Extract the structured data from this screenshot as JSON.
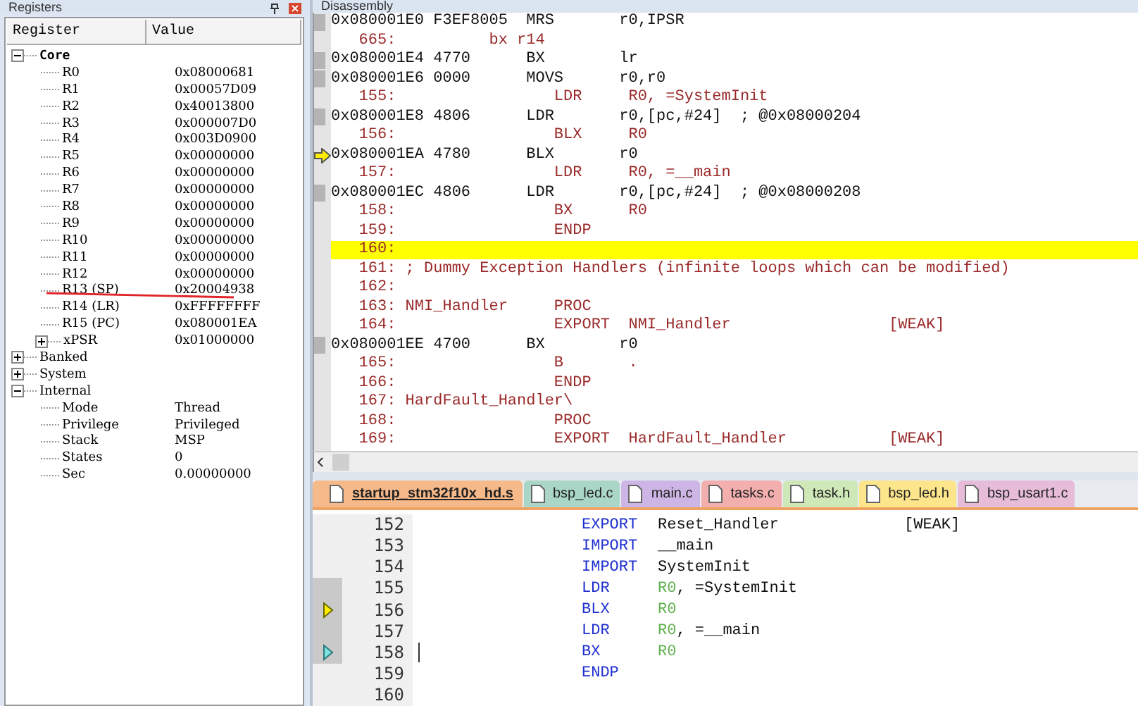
{
  "registers": {
    "title": "Registers",
    "columns": [
      "Register",
      "Value"
    ],
    "tree": [
      {
        "name": "Core",
        "bold": true,
        "expanded": true,
        "children": [
          {
            "name": "R0",
            "value": "0x08000681"
          },
          {
            "name": "R1",
            "value": "0x00057D09"
          },
          {
            "name": "R2",
            "value": "0x40013800"
          },
          {
            "name": "R3",
            "value": "0x000007D0"
          },
          {
            "name": "R4",
            "value": "0x003D0900"
          },
          {
            "name": "R5",
            "value": "0x00000000"
          },
          {
            "name": "R6",
            "value": "0x00000000"
          },
          {
            "name": "R7",
            "value": "0x00000000"
          },
          {
            "name": "R8",
            "value": "0x00000000"
          },
          {
            "name": "R9",
            "value": "0x00000000"
          },
          {
            "name": "R10",
            "value": "0x00000000"
          },
          {
            "name": "R11",
            "value": "0x00000000"
          },
          {
            "name": "R12",
            "value": "0x00000000"
          },
          {
            "name": "R13 (SP)",
            "value": "0x20004938"
          },
          {
            "name": "R14 (LR)",
            "value": "0xFFFFFFFF"
          },
          {
            "name": "R15 (PC)",
            "value": "0x080001EA"
          },
          {
            "name": "xPSR",
            "value": "0x01000000",
            "expanded": false
          }
        ]
      },
      {
        "name": "Banked",
        "bold": false,
        "expanded": false
      },
      {
        "name": "System",
        "bold": false,
        "expanded": false
      },
      {
        "name": "Internal",
        "bold": false,
        "expanded": true,
        "children": [
          {
            "name": "Mode",
            "value": "Thread"
          },
          {
            "name": "Privilege",
            "value": "Privileged"
          },
          {
            "name": "Stack",
            "value": "MSP"
          },
          {
            "name": "States",
            "value": "0"
          },
          {
            "name": "Sec",
            "value": "0.00000000"
          }
        ]
      }
    ]
  },
  "disassembly": {
    "title": "Disassembly",
    "lines": [
      {
        "kind": "asm",
        "text": "0x080001E0 F3EF8005  MRS       r0,IPSR",
        "current": false,
        "highlighted": false
      },
      {
        "kind": "src",
        "text": "   665:          bx r14",
        "current": false,
        "highlighted": false
      },
      {
        "kind": "asm",
        "text": "0x080001E4 4770      BX        lr",
        "current": false,
        "highlighted": false
      },
      {
        "kind": "asm",
        "text": "0x080001E6 0000      MOVS      r0,r0",
        "current": false,
        "highlighted": false
      },
      {
        "kind": "src",
        "text": "   155:                 LDR     R0, =SystemInit",
        "current": false,
        "highlighted": false
      },
      {
        "kind": "asm",
        "text": "0x080001E8 4806      LDR       r0,[pc,#24]  ; @0x08000204",
        "current": false,
        "highlighted": false
      },
      {
        "kind": "src",
        "text": "   156:                 BLX     R0",
        "current": false,
        "highlighted": false
      },
      {
        "kind": "asm",
        "text": "0x080001EA 4780      BLX       r0",
        "current": true,
        "highlighted": false
      },
      {
        "kind": "src",
        "text": "   157:                 LDR     R0, =__main",
        "current": false,
        "highlighted": false
      },
      {
        "kind": "asm",
        "text": "0x080001EC 4806      LDR       r0,[pc,#24]  ; @0x08000208",
        "current": false,
        "highlighted": false
      },
      {
        "kind": "src",
        "text": "   158:                 BX      R0",
        "current": false,
        "highlighted": false
      },
      {
        "kind": "src",
        "text": "   159:                 ENDP",
        "current": false,
        "highlighted": false
      },
      {
        "kind": "src",
        "text": "   160:",
        "current": false,
        "highlighted": true
      },
      {
        "kind": "src",
        "text": "   161: ; Dummy Exception Handlers (infinite loops which can be modified)",
        "current": false,
        "highlighted": false
      },
      {
        "kind": "src",
        "text": "   162:",
        "current": false,
        "highlighted": false
      },
      {
        "kind": "src",
        "text": "   163: NMI_Handler     PROC",
        "current": false,
        "highlighted": false
      },
      {
        "kind": "src",
        "text": "   164:                 EXPORT  NMI_Handler                 [WEAK]",
        "current": false,
        "highlighted": false
      },
      {
        "kind": "asm",
        "text": "0x080001EE 4700      BX        r0",
        "current": false,
        "highlighted": false
      },
      {
        "kind": "src",
        "text": "   165:                 B       .",
        "current": false,
        "highlighted": false
      },
      {
        "kind": "src",
        "text": "   166:                 ENDP",
        "current": false,
        "highlighted": false
      },
      {
        "kind": "src",
        "text": "   167: HardFault_Handler\\",
        "current": false,
        "highlighted": false
      },
      {
        "kind": "src",
        "text": "   168:                 PROC",
        "current": false,
        "highlighted": false
      },
      {
        "kind": "src",
        "text": "   169:                 EXPORT  HardFault_Handler           [WEAK]",
        "current": false,
        "highlighted": false
      }
    ]
  },
  "tabs": [
    {
      "label": "startup_stm32f10x_hd.s",
      "selected": true,
      "color": "#f6b98a"
    },
    {
      "label": "bsp_led.c",
      "selected": false,
      "color": "#a9d6c6"
    },
    {
      "label": "main.c",
      "selected": false,
      "color": "#cdb6e6"
    },
    {
      "label": "tasks.c",
      "selected": false,
      "color": "#f3aeae"
    },
    {
      "label": "task.h",
      "selected": false,
      "color": "#cfe8b8"
    },
    {
      "label": "bsp_led.h",
      "selected": false,
      "color": "#fde58c"
    },
    {
      "label": "bsp_usart1.c",
      "selected": false,
      "color": "#e6bcd9"
    }
  ],
  "editor": {
    "lines": [
      {
        "number": "152",
        "pc_arrow": false,
        "cursor_arrow": false,
        "in_block": false,
        "keyword": "EXPORT",
        "operands": [
          {
            "text": "Reset_Handler",
            "kind": "symbol"
          }
        ],
        "attribute": "[WEAK]"
      },
      {
        "number": "153",
        "pc_arrow": false,
        "cursor_arrow": false,
        "in_block": false,
        "keyword": "IMPORT",
        "operands": [
          {
            "text": "__main",
            "kind": "symbol"
          }
        ]
      },
      {
        "number": "154",
        "pc_arrow": false,
        "cursor_arrow": false,
        "in_block": false,
        "keyword": "IMPORT",
        "operands": [
          {
            "text": "SystemInit",
            "kind": "symbol"
          }
        ]
      },
      {
        "number": "155",
        "pc_arrow": false,
        "cursor_arrow": false,
        "in_block": true,
        "keyword": "LDR",
        "operands": [
          {
            "text": "R0",
            "kind": "register"
          },
          {
            "text": ", =SystemInit",
            "kind": "symbol"
          }
        ]
      },
      {
        "number": "156",
        "pc_arrow": true,
        "cursor_arrow": false,
        "in_block": true,
        "keyword": "BLX",
        "operands": [
          {
            "text": "R0",
            "kind": "register"
          }
        ]
      },
      {
        "number": "157",
        "pc_arrow": false,
        "cursor_arrow": false,
        "in_block": true,
        "keyword": "LDR",
        "operands": [
          {
            "text": "R0",
            "kind": "register"
          },
          {
            "text": ", =__main",
            "kind": "symbol"
          }
        ]
      },
      {
        "number": "158",
        "pc_arrow": false,
        "cursor_arrow": true,
        "in_block": true,
        "keyword": "BX",
        "operands": [
          {
            "text": "R0",
            "kind": "register"
          }
        ],
        "caret": true
      },
      {
        "number": "159",
        "pc_arrow": false,
        "cursor_arrow": false,
        "in_block": false,
        "keyword": "ENDP"
      },
      {
        "number": "160",
        "pc_arrow": false,
        "cursor_arrow": false,
        "in_block": false
      }
    ]
  }
}
